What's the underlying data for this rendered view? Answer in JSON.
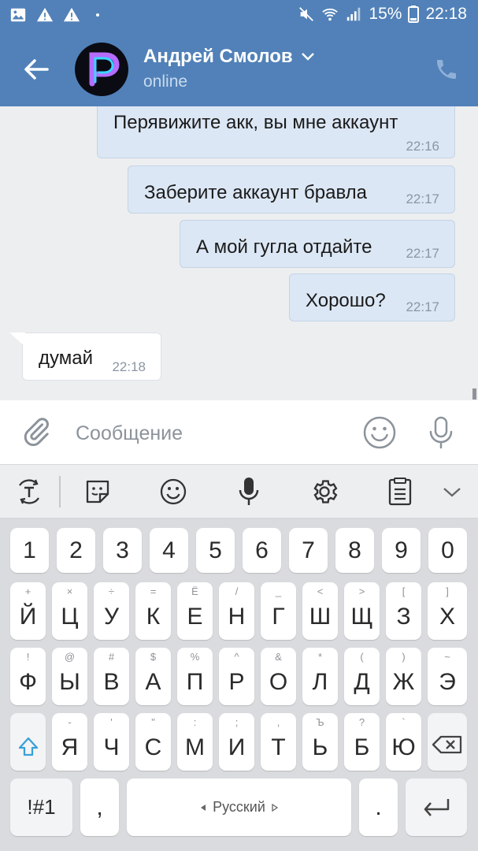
{
  "status_bar": {
    "battery": "15%",
    "time": "22:18"
  },
  "header": {
    "contact_name": "Андрей Смолов",
    "status": "online"
  },
  "messages": [
    {
      "text": "Перявижите акк, вы мне аккаунт",
      "time": "22:16",
      "direction": "out"
    },
    {
      "text": "Заберите аккаунт бравла",
      "time": "22:17",
      "direction": "out"
    },
    {
      "text": "А мой гугла отдайте",
      "time": "22:17",
      "direction": "out"
    },
    {
      "text": "Хорошо?",
      "time": "22:17",
      "direction": "out"
    },
    {
      "text": "думай",
      "time": "22:18",
      "direction": "in"
    }
  ],
  "composer": {
    "placeholder": "Сообщение"
  },
  "keyboard": {
    "numbers": [
      "1",
      "2",
      "3",
      "4",
      "5",
      "6",
      "7",
      "8",
      "9",
      "0"
    ],
    "row1": [
      {
        "main": "Й",
        "sub": "+"
      },
      {
        "main": "Ц",
        "sub": "×"
      },
      {
        "main": "У",
        "sub": "÷"
      },
      {
        "main": "К",
        "sub": "="
      },
      {
        "main": "Е",
        "sub": "Ё"
      },
      {
        "main": "Н",
        "sub": "/"
      },
      {
        "main": "Г",
        "sub": "_"
      },
      {
        "main": "Ш",
        "sub": "<"
      },
      {
        "main": "Щ",
        "sub": ">"
      },
      {
        "main": "З",
        "sub": "["
      },
      {
        "main": "Х",
        "sub": "]"
      }
    ],
    "row2": [
      {
        "main": "Ф",
        "sub": "!"
      },
      {
        "main": "Ы",
        "sub": "@"
      },
      {
        "main": "В",
        "sub": "#"
      },
      {
        "main": "А",
        "sub": "$"
      },
      {
        "main": "П",
        "sub": "%"
      },
      {
        "main": "Р",
        "sub": "^"
      },
      {
        "main": "О",
        "sub": "&"
      },
      {
        "main": "Л",
        "sub": "*"
      },
      {
        "main": "Д",
        "sub": "("
      },
      {
        "main": "Ж",
        "sub": ")"
      },
      {
        "main": "Э",
        "sub": "~"
      }
    ],
    "row3": [
      {
        "main": "Я",
        "sub": "-"
      },
      {
        "main": "Ч",
        "sub": "'"
      },
      {
        "main": "С",
        "sub": "\""
      },
      {
        "main": "М",
        "sub": ":"
      },
      {
        "main": "И",
        "sub": ";"
      },
      {
        "main": "Т",
        "sub": ","
      },
      {
        "main": "Ь",
        "sub": "Ъ"
      },
      {
        "main": "Б",
        "sub": "?"
      },
      {
        "main": "Ю",
        "sub": "`"
      }
    ],
    "symbols_label": "!#1",
    "comma_label": ",",
    "space_label": "Русский",
    "period_label": "."
  },
  "colors": {
    "header": "#5181b8",
    "bubble_out": "#dce7f5",
    "bubble_in": "#ffffff",
    "keyboard_bg": "#d9dbde"
  }
}
